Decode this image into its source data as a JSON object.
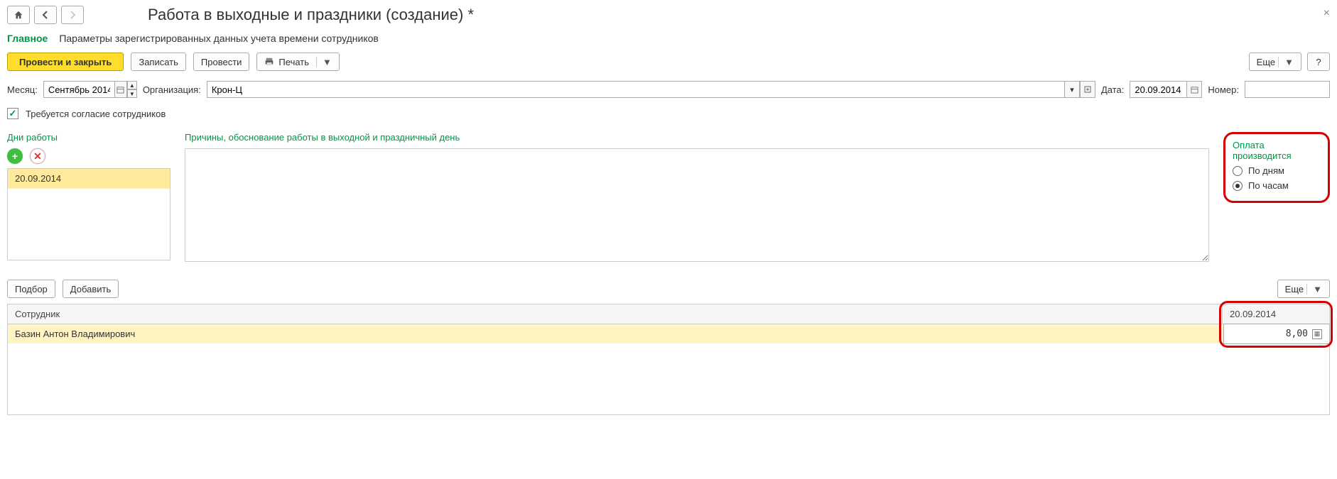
{
  "title": "Работа в выходные и праздники (создание) *",
  "tabs": {
    "active": "Главное",
    "other": "Параметры зарегистрированных данных учета времени сотрудников"
  },
  "toolbar": {
    "post_close": "Провести и закрыть",
    "save": "Записать",
    "post": "Провести",
    "print": "Печать",
    "more": "Еще",
    "help": "?"
  },
  "fields": {
    "month_label": "Месяц:",
    "month_value": "Сентябрь 2014",
    "org_label": "Организация:",
    "org_value": "Крон-Ц",
    "date_label": "Дата:",
    "date_value": "20.09.2014",
    "number_label": "Номер:",
    "number_value": ""
  },
  "consent": {
    "checked": true,
    "label": "Требуется согласие сотрудников"
  },
  "days": {
    "header": "Дни работы",
    "items": [
      "20.09.2014"
    ]
  },
  "reason": {
    "header": "Причины, обоснование работы в выходной и праздничный день",
    "value": ""
  },
  "payment": {
    "header": "Оплата производится",
    "by_days": "По дням",
    "by_hours": "По часам",
    "selected": "by_hours"
  },
  "employees_toolbar": {
    "pick": "Подбор",
    "add": "Добавить",
    "more": "Еще"
  },
  "table": {
    "col_employee": "Сотрудник",
    "col_date": "20.09.2014",
    "rows": [
      {
        "name": "Базин Антон Владимирович",
        "hours": "8,00"
      }
    ]
  }
}
